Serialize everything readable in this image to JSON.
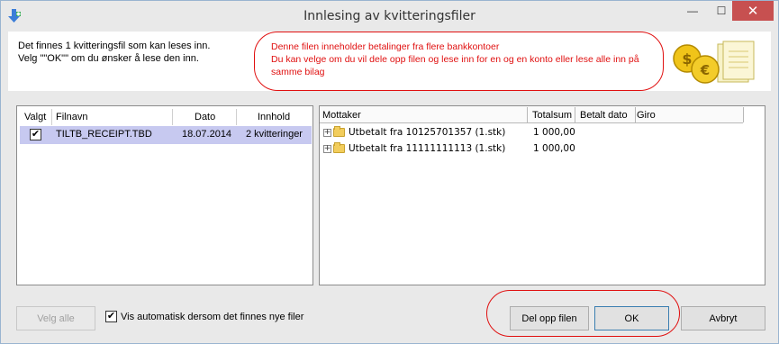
{
  "window": {
    "title": "Innlesing av kvitteringsfiler",
    "controls": {
      "minimize": "—",
      "maximize": "☐",
      "close": "✕"
    }
  },
  "header": {
    "info_line1": "Det finnes 1 kvitteringsfil som kan leses inn.",
    "info_line2": "Velg \"\"OK\"\" om du ønsker å lese den inn.",
    "warning_line1": "Denne filen inneholder betalinger fra flere bankkontoer",
    "warning_line2": "Du kan velge om du vil dele opp filen og lese inn for en og en konto eller lese alle inn på",
    "warning_line3": "samme bilag",
    "accent_warning": "#e01010"
  },
  "file_list": {
    "columns": [
      "Valgt",
      "Filnavn",
      "Dato",
      "Innhold"
    ],
    "rows": [
      {
        "selected": true,
        "filename": "TILTB_RECEIPT.TBD",
        "date": "18.07.2014",
        "content": "2 kvitteringer"
      }
    ]
  },
  "detail_tree": {
    "columns": [
      "Mottaker",
      "Totalsum",
      "Betalt dato",
      "Giro"
    ],
    "rows": [
      {
        "label": "Utbetalt fra 10125701357 (1.stk)",
        "total": "1 000,00"
      },
      {
        "label": "Utbetalt fra 11111111113 (1.stk)",
        "total": "1 000,00"
      }
    ]
  },
  "footer": {
    "select_all": "Velg alle",
    "auto_show_label": "Vis automatisk dersom det finnes nye filer",
    "auto_show_checked": true,
    "split_label": "Del opp filen",
    "ok_label": "OK",
    "cancel_label": "Avbryt"
  }
}
